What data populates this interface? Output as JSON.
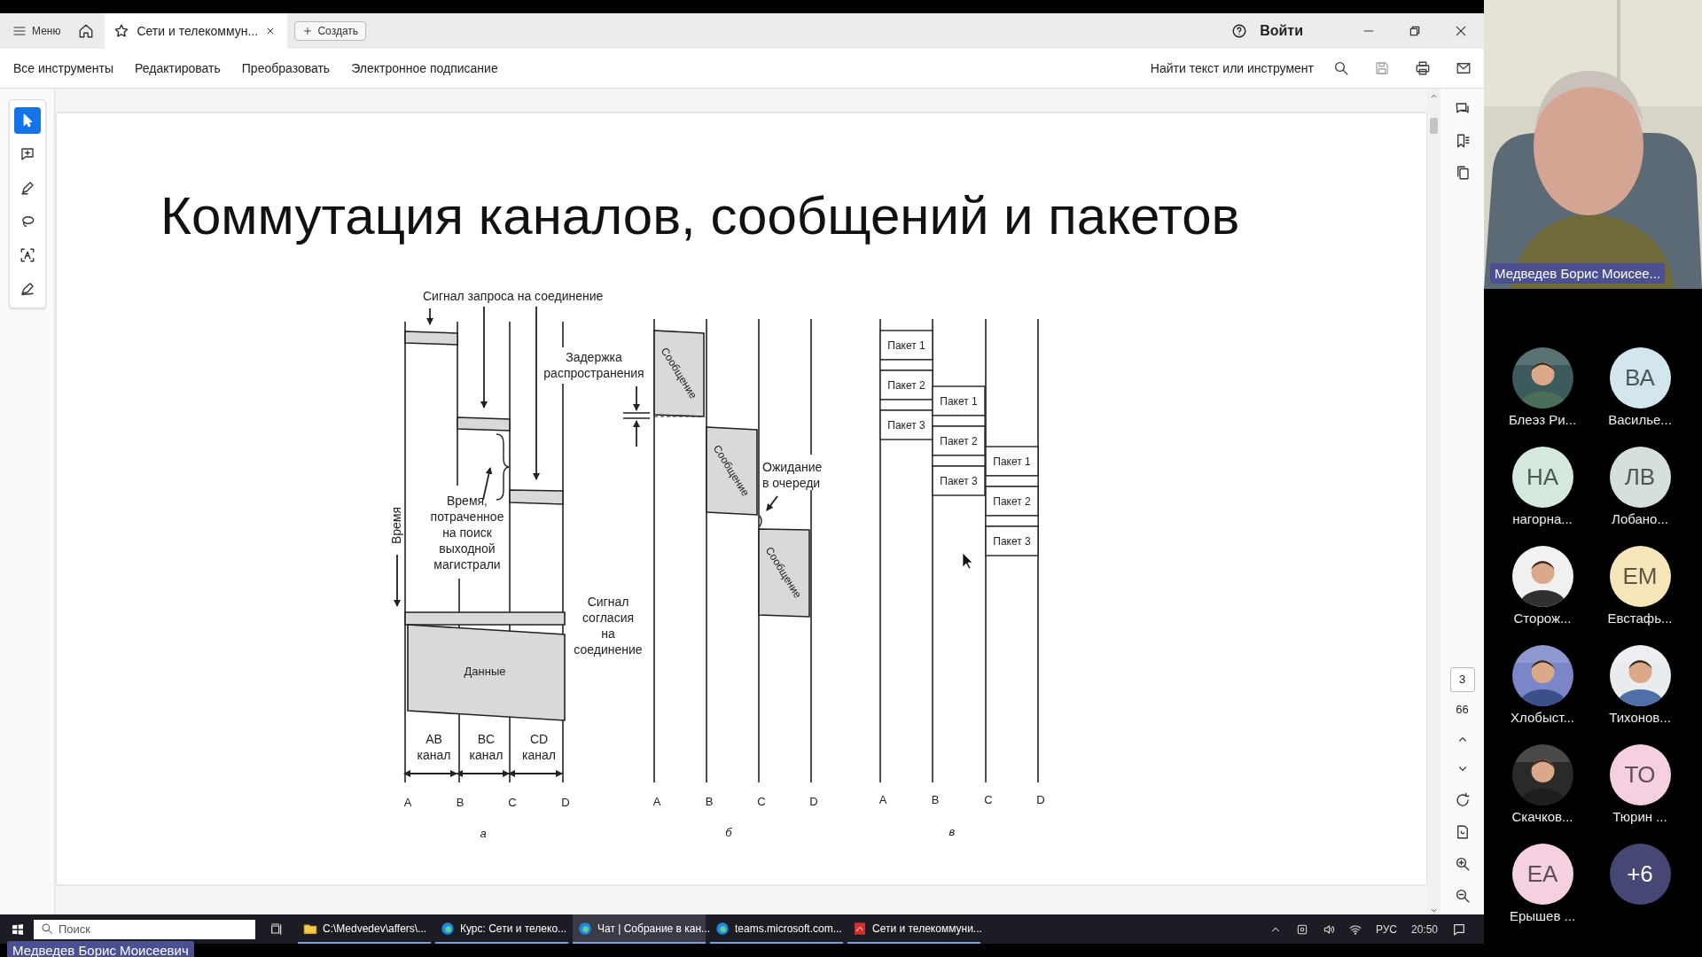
{
  "app_tabs": {
    "menu": "Меню",
    "document_tab": {
      "title": "Сети и телекоммун...",
      "selected": true
    },
    "create": "Создать",
    "sign_in": "Войти"
  },
  "toolbar": {
    "items": [
      "Все инструменты",
      "Редактировать",
      "Преобразовать",
      "Электронное подписание"
    ],
    "search": "Найти текст или инструмент"
  },
  "left_tools": [
    {
      "kind": "select",
      "selected": true
    },
    {
      "kind": "comment",
      "selected": false
    },
    {
      "kind": "pen",
      "selected": false
    },
    {
      "kind": "lasso",
      "selected": false
    },
    {
      "kind": "text",
      "selected": false
    },
    {
      "kind": "sign",
      "selected": false
    }
  ],
  "page": {
    "title": "Коммутация каналов, сообщений и пакетов",
    "figure": {
      "panel_a": {
        "request_signal": "Сигнал запроса на соединение",
        "time_axis": "Время",
        "search_time": "Время,\nпотраченное\nна поиск\nвыходной\nмагистрали",
        "ack_signal": "Сигнал\nсогласия\nна\nсоединение",
        "data": "Данные",
        "channels": [
          "AB\nканал",
          "BC\nканал",
          "CD\nканал"
        ],
        "nodes": [
          "A",
          "B",
          "C",
          "D"
        ],
        "caption": "а"
      },
      "panel_b": {
        "propagation_delay": "Задержка\nраспространения",
        "messages": [
          "Сообщение",
          "Сообщение",
          "Сообщение"
        ],
        "queue_wait": "Ожидание\nв очереди",
        "nodes": [
          "A",
          "B",
          "C",
          "D"
        ],
        "caption": "б"
      },
      "panel_c": {
        "hops": [
          [
            "Пакет 1",
            "Пакет 2",
            "Пакет 3"
          ],
          [
            "Пакет 1",
            "Пакет 2",
            "Пакет 3"
          ],
          [
            "Пакет 1",
            "Пакет 2",
            "Пакет 3"
          ]
        ],
        "nodes": [
          "A",
          "B",
          "C",
          "D"
        ],
        "caption": "в"
      }
    }
  },
  "page_nav": {
    "current": "3",
    "total": "66"
  },
  "taskbar": {
    "search_placeholder": "Поиск",
    "apps": [
      {
        "kind": "folder",
        "label": "C:\\Medvedev\\affers\\...",
        "selected": false
      },
      {
        "kind": "browser",
        "label": "Курс: Сети и телеко...",
        "selected": false
      },
      {
        "kind": "browser",
        "label": "Чат | Собрание в кан...",
        "selected": true
      },
      {
        "kind": "browser",
        "label": "teams.microsoft.com...",
        "selected": false
      },
      {
        "kind": "pdf",
        "label": "Сети и телекоммуни...",
        "selected": false
      }
    ],
    "language": "РУС",
    "time": "20:50"
  },
  "presenter_label": "Медведев Борис Моисеевич",
  "meeting": {
    "speaker_name": "Медведев Борис Моисее...",
    "participant_rows": [
      [
        {
          "name": "Блеэз Ри..."
        },
        {
          "kind": "initials",
          "initials": "ВА",
          "color": "#d3e6ee",
          "name": "Василье..."
        }
      ],
      [
        {
          "kind": "initials",
          "initials": "НА",
          "color": "#d2e9dc",
          "name": "нагорна..."
        },
        {
          "kind": "initials",
          "initials": "ЛВ",
          "color": "#d6e0da",
          "name": "Лобано..."
        }
      ],
      [
        {
          "name": "Сторож..."
        },
        {
          "kind": "initials",
          "initials": "ЕМ",
          "color": "#f7e6b9",
          "name": "Евстафь..."
        }
      ],
      [
        {
          "name": "Хлобыст..."
        },
        {
          "name": "Тихонов..."
        }
      ],
      [
        {
          "name": "Скачков..."
        },
        {
          "kind": "initials",
          "initials": "ТО",
          "color": "#f4d0e1",
          "name": "Тюрин ..."
        }
      ],
      [
        {
          "kind": "initials",
          "initials": "ЕА",
          "color": "#f4d0e1",
          "name": "Ерышев ..."
        },
        {
          "kind": "more",
          "initials": "+6",
          "color": "#464775"
        }
      ]
    ]
  }
}
